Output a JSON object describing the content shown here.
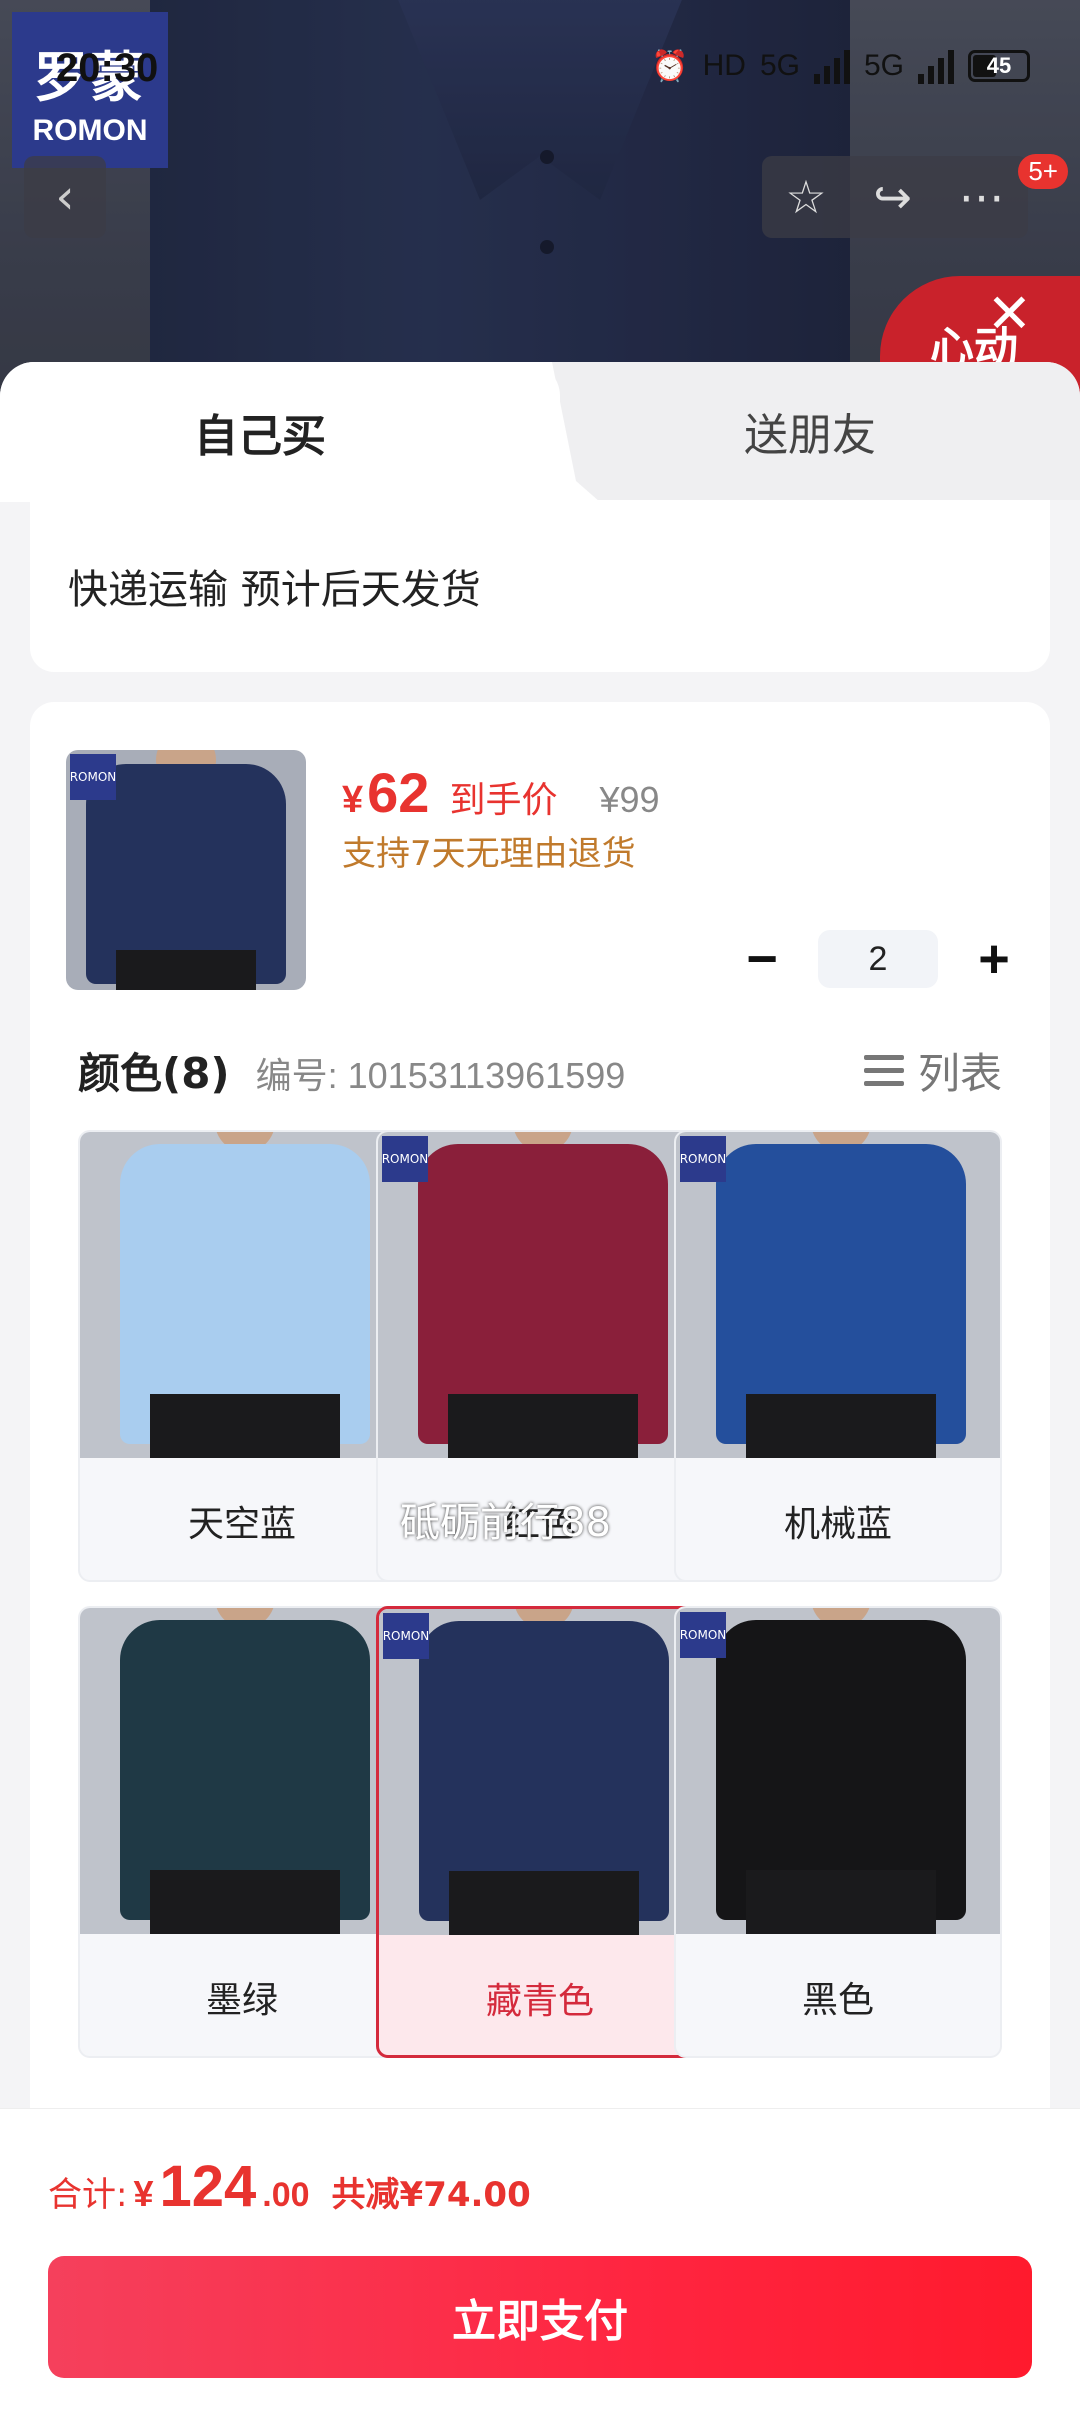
{
  "status_bar": {
    "time": "20:30",
    "network_1": "HD",
    "network_2": "5G",
    "network_3": "5G",
    "battery": "45"
  },
  "brand": {
    "logo_cn": "罗蒙",
    "logo_en": "ROMON"
  },
  "header": {
    "badge": "5+",
    "banner_text": "心动"
  },
  "tabs": [
    {
      "label": "自己买",
      "active": true
    },
    {
      "label": "送朋友",
      "active": false
    }
  ],
  "delivery": {
    "text": "快递运输 预计后天发货"
  },
  "product": {
    "price_symbol": "¥",
    "price": "62",
    "price_label": "到手价",
    "original_price": "¥99",
    "return_policy": "支持7天无理由退货",
    "quantity": "2",
    "minus": "−",
    "plus": "+"
  },
  "colors": {
    "title": "颜色(8)",
    "sku": "编号: 10153113961599",
    "list_label": "列表",
    "items": [
      {
        "label": "天空蓝",
        "shirt_color": "#a9cdef"
      },
      {
        "label": "红色",
        "shirt_color": "#8a1f3a"
      },
      {
        "label": "机械蓝",
        "shirt_color": "#244f9c"
      },
      {
        "label": "墨绿",
        "shirt_color": "#1f3945"
      },
      {
        "label": "藏青色",
        "shirt_color": "#24325c",
        "selected": true
      },
      {
        "label": "黑色",
        "shirt_color": "#151517"
      }
    ]
  },
  "watermark": "砥砺前行88",
  "total": {
    "label": "合计:",
    "symbol": "¥",
    "integer": "124",
    "decimal": ".00",
    "saved": "共减¥74.00"
  },
  "pay_button": "立即支付",
  "accent_color": "#e8332f"
}
